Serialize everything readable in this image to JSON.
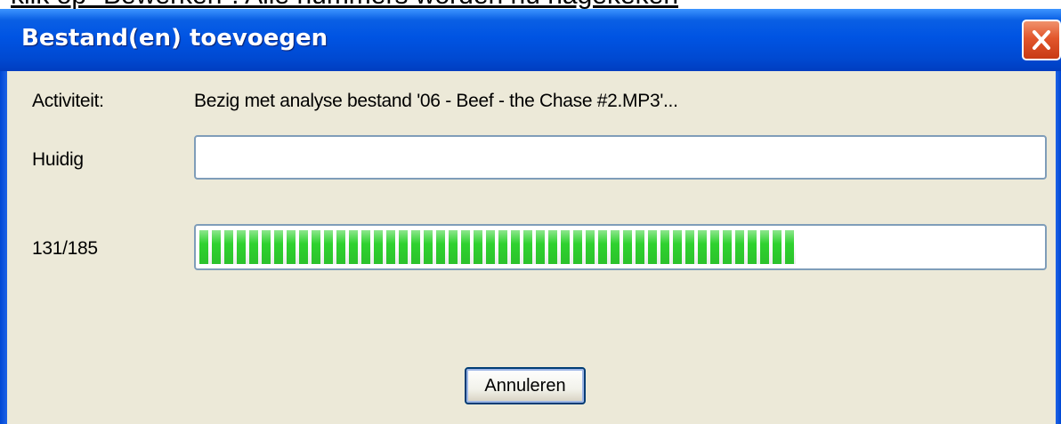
{
  "background_caption": "klik op \"Bewerken\". Alle nummers worden nu nagekeken",
  "dialog": {
    "title": "Bestand(en) toevoegen",
    "close_icon": "close-icon",
    "activity_label": "Activiteit:",
    "activity_text": "Bezig met analyse bestand '06 - Beef - the Chase #2.MP3'...",
    "current_label": "Huidig",
    "current_value": "",
    "progress_label": "131/185",
    "progress_fraction": 0.708,
    "cancel_label": "Annuleren"
  },
  "colors": {
    "titlebar": "#0054e3",
    "dialog_bg": "#ece9d8",
    "progress_green": "#2fd22f",
    "close_red": "#e2562c"
  }
}
